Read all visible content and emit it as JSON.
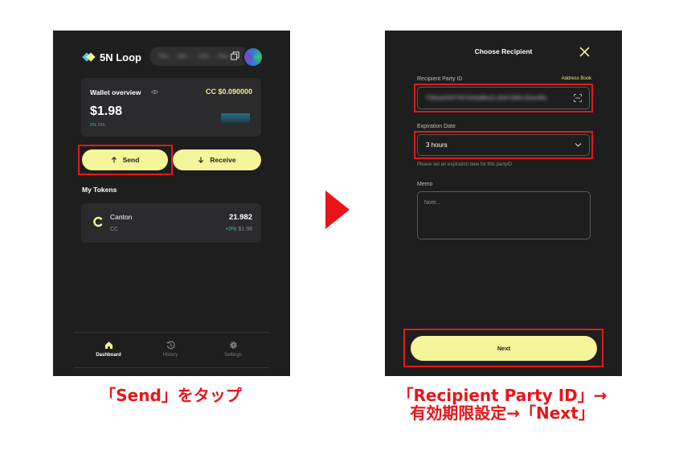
{
  "left_screen": {
    "app_name": "5N Loop",
    "address_masked": "f5a...a8c...333...5ae",
    "wallet": {
      "title": "Wallet overview",
      "cc_balance": "CC $0.090000",
      "usd_balance": "$1.98",
      "change_pct": "0%",
      "change_period": "24h"
    },
    "actions": {
      "send": "Send",
      "receive": "Receive"
    },
    "tokens_title": "My Tokens",
    "tokens": [
      {
        "name": "Canton",
        "symbol": "CC",
        "amount": "21.982",
        "change": "+0%",
        "usd": "$1.98"
      }
    ],
    "nav": {
      "dashboard": "Dashboard",
      "history": "History",
      "settings": "Settings"
    }
  },
  "right_screen": {
    "title": "Choose Recipient",
    "recipient_label": "Recipient Party ID",
    "address_book": "Address Book",
    "recipient_value": "f5baae59f76f416a8be2c1b47269c32ae99c",
    "expiration_label": "Expiration Date",
    "expiration_value": "3 hours",
    "expiration_help": "Please set an expiration date for this partyID",
    "memo_label": "Memo",
    "memo_placeholder": "Note...",
    "next": "Next"
  },
  "captions": {
    "left": "「Send」をタップ",
    "right_line1": "「Recipient Party ID」→",
    "right_line2": "有効期限設定→「Next」"
  },
  "colors": {
    "accent": "#f5f59a",
    "highlight": "#e01a1a",
    "positive": "#3ec28f",
    "background": "#1e1e1e"
  }
}
